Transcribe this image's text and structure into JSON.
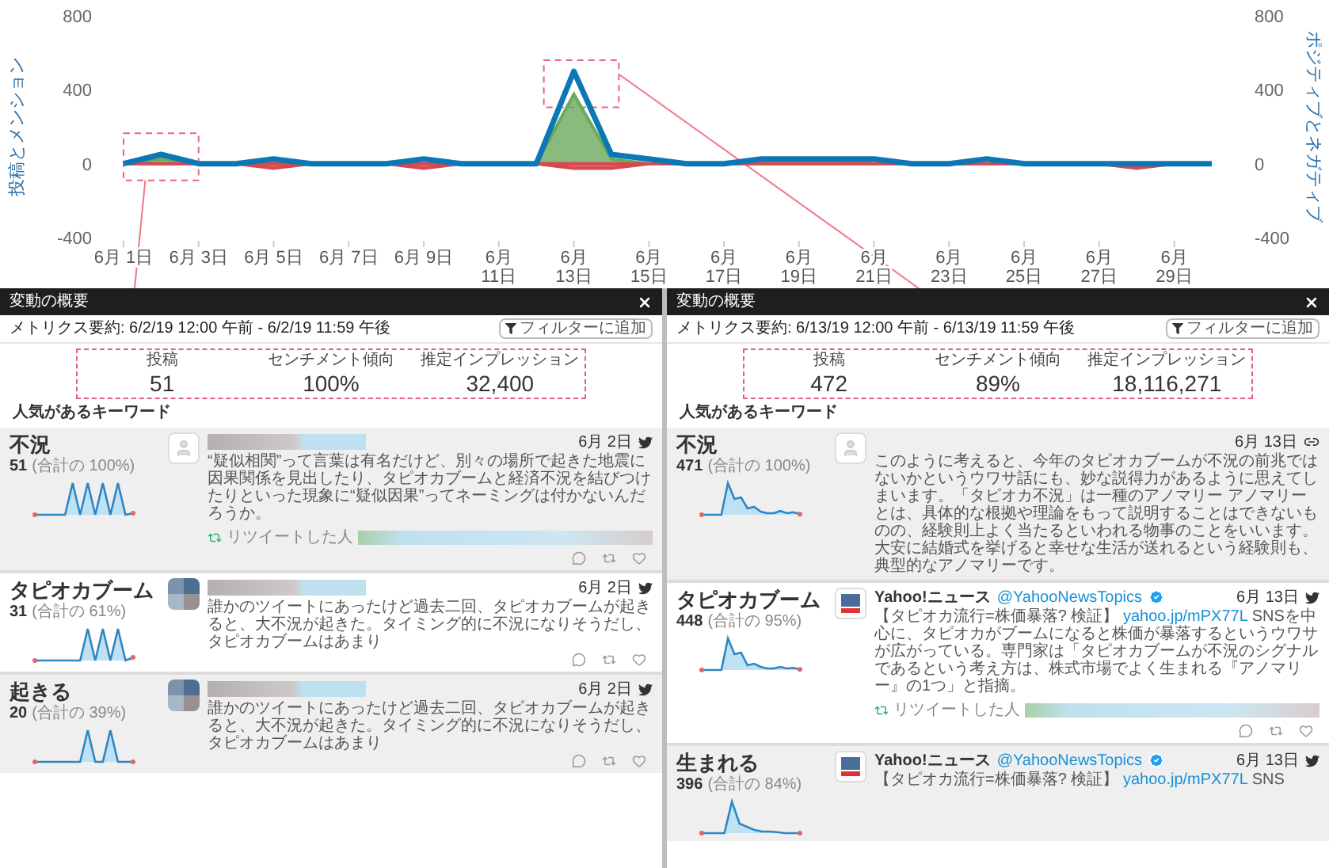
{
  "chart": {
    "chart_data": {
      "type": "line",
      "ylabel": "投稿とメンション",
      "y2label": "ポジティブとネガティブ",
      "ylim": [
        -400,
        800
      ],
      "y2lim": [
        -400,
        800
      ],
      "yticks": [
        800,
        400,
        0,
        -400
      ],
      "y2ticks": [
        800,
        400,
        0,
        -400
      ],
      "categories": [
        "6月 1日",
        null,
        "6月 3日",
        null,
        "6月 5日",
        null,
        "6月 7日",
        null,
        "6月 9日",
        null,
        "6月\n11日",
        null,
        "6月\n13日",
        null,
        "6月\n15日",
        null,
        "6月\n17日",
        null,
        "6月\n19日",
        null,
        "6月\n21日",
        null,
        "6月\n23日",
        null,
        "6月\n25日",
        null,
        "6月\n27日",
        null,
        "6月\n29日",
        null
      ],
      "series": [
        {
          "type": "area",
          "color": "#6aaa5c",
          "values": [
            0,
            25,
            0,
            0,
            25,
            0,
            0,
            0,
            0,
            0,
            0,
            0,
            375,
            25,
            0,
            0,
            0,
            25,
            25,
            25,
            0,
            0,
            0,
            0,
            0,
            0,
            0,
            0,
            0,
            0
          ]
        },
        {
          "type": "area",
          "color": "#d9474f",
          "values": [
            0,
            0,
            0,
            0,
            -25,
            0,
            0,
            0,
            -25,
            0,
            0,
            0,
            -25,
            -25,
            0,
            0,
            0,
            0,
            0,
            0,
            0,
            0,
            0,
            0,
            0,
            0,
            0,
            -25,
            0,
            0
          ]
        },
        {
          "type": "line",
          "color": "#0b78b5",
          "values": [
            0,
            50,
            0,
            0,
            25,
            0,
            0,
            0,
            25,
            0,
            0,
            0,
            500,
            50,
            25,
            0,
            0,
            25,
            25,
            25,
            25,
            0,
            0,
            25,
            0,
            0,
            0,
            0,
            0,
            0
          ]
        }
      ]
    }
  },
  "panels": [
    {
      "title": "変動の概要",
      "summary": "メトリクス要約: 6/2/19 12:00 午前 - 6/2/19 11:59 午後",
      "filter_button": "フィルターに追加",
      "metrics": [
        {
          "label": "投稿",
          "value": "51"
        },
        {
          "label": "センチメント傾向",
          "value": "100%"
        },
        {
          "label": "推定インプレッション",
          "value": "32,400"
        }
      ],
      "keywords_heading": "人気があるキーワード",
      "keywords": [
        {
          "keyword": "不況",
          "count": "51",
          "share": "(合計の 100%)",
          "selected": false,
          "tweet": {
            "avatar": {
              "kind": "default"
            },
            "author_hidden": true,
            "date": "6月 2日",
            "source": {
              "kind": "twitter"
            },
            "text": "“疑似相関”って言葉は有名だけど、別々の場所で起きた地震に因果関係を見出したり、タピオカブームと経済不況を結びつけたりといった現象に“疑似因果”ってネーミングは付かないんだろうか。",
            "retweeted_by": "リツイートした人",
            "actions": true
          }
        },
        {
          "keyword": "タピオカブーム",
          "count": "31",
          "share": "(合計の 61%)",
          "selected": true,
          "tweet": {
            "avatar": {
              "kind": "pixelated"
            },
            "author_hidden": true,
            "date": "6月 2日",
            "source": {
              "kind": "twitter"
            },
            "text": "誰かのツイートにあったけど過去二回、タピオカブームが起きると、大不況が起きた。タイミング的に不況になりそうだし、タピオカブームはあまり",
            "actions": true
          }
        },
        {
          "keyword": "起きる",
          "count": "20",
          "share": "(合計の 39%)",
          "selected": false,
          "tweet": {
            "avatar": {
              "kind": "pixelated"
            },
            "author_hidden": true,
            "date": "6月 2日",
            "source": {
              "kind": "twitter"
            },
            "text": "誰かのツイートにあったけど過去二回、タピオカブームが起きると、大不況が起きた。タイミング的に不況になりそうだし、タピオカブームはあまり",
            "actions": true
          }
        }
      ]
    },
    {
      "title": "変動の概要",
      "summary": "メトリクス要約: 6/13/19 12:00 午前 - 6/13/19 11:59 午後",
      "filter_button": "フィルターに追加",
      "metrics": [
        {
          "label": "投稿",
          "value": "472"
        },
        {
          "label": "センチメント傾向",
          "value": "89%"
        },
        {
          "label": "推定インプレッション",
          "value": "18,116,271"
        }
      ],
      "keywords_heading": "人気があるキーワード",
      "keywords": [
        {
          "keyword": "不況",
          "count": "471",
          "share": "(合計の 100%)",
          "selected": false,
          "tweet": {
            "avatar": {
              "kind": "default"
            },
            "author_hidden": false,
            "date": "6月 13日",
            "source": {
              "kind": "web"
            },
            "text": "このように考えると、今年のタピオカブームが不況の前兆ではないかというウワサ話にも、妙な説得力があるように思えてしまいます。「タピオカ不況」は一種のアノマリー アノマリーとは、具体的な根拠や理論をもって説明することはできないものの、経験則上よく当たるといわれる物事のことをいいます。大安に結婚式を挙げると幸せな生活が送れるという経験則も、典型的なアノマリーです。",
            "actions": false
          }
        },
        {
          "keyword": "タピオカブーム",
          "count": "448",
          "share": "(合計の 95%)",
          "selected": true,
          "tweet": {
            "avatar": {
              "kind": "logo"
            },
            "author_hidden": false,
            "author": "Yahoo!ニュース",
            "handle": "@YahooNewsTopics",
            "verified": true,
            "date": "6月 13日",
            "source": {
              "kind": "twitter"
            },
            "text": "【タピオカ流行=株価暴落? 検証】 ",
            "link": "yahoo.jp/mPX77L",
            "text_after": " SNSを中心に、タピオカがブームになると株価が暴落するというウワサが広がっている。専門家は「タピオカブームが不況のシグナルであるという考え方は、株式市場でよく生まれる『アノマリー』の1つ」と指摘。",
            "retweeted_by": "リツイートした人",
            "actions": true
          }
        },
        {
          "keyword": "生まれる",
          "count": "396",
          "share": "(合計の 84%)",
          "selected": false,
          "tweet": {
            "avatar": {
              "kind": "logo"
            },
            "author_hidden": false,
            "author": "Yahoo!ニュース",
            "handle": "@YahooNewsTopics",
            "verified": true,
            "date": "6月 13日",
            "source": {
              "kind": "twitter"
            },
            "text": "【タピオカ流行=株価暴落? 検証】 ",
            "link": "yahoo.jp/mPX77L",
            "text_after": " SNS",
            "actions": false
          }
        }
      ]
    }
  ]
}
